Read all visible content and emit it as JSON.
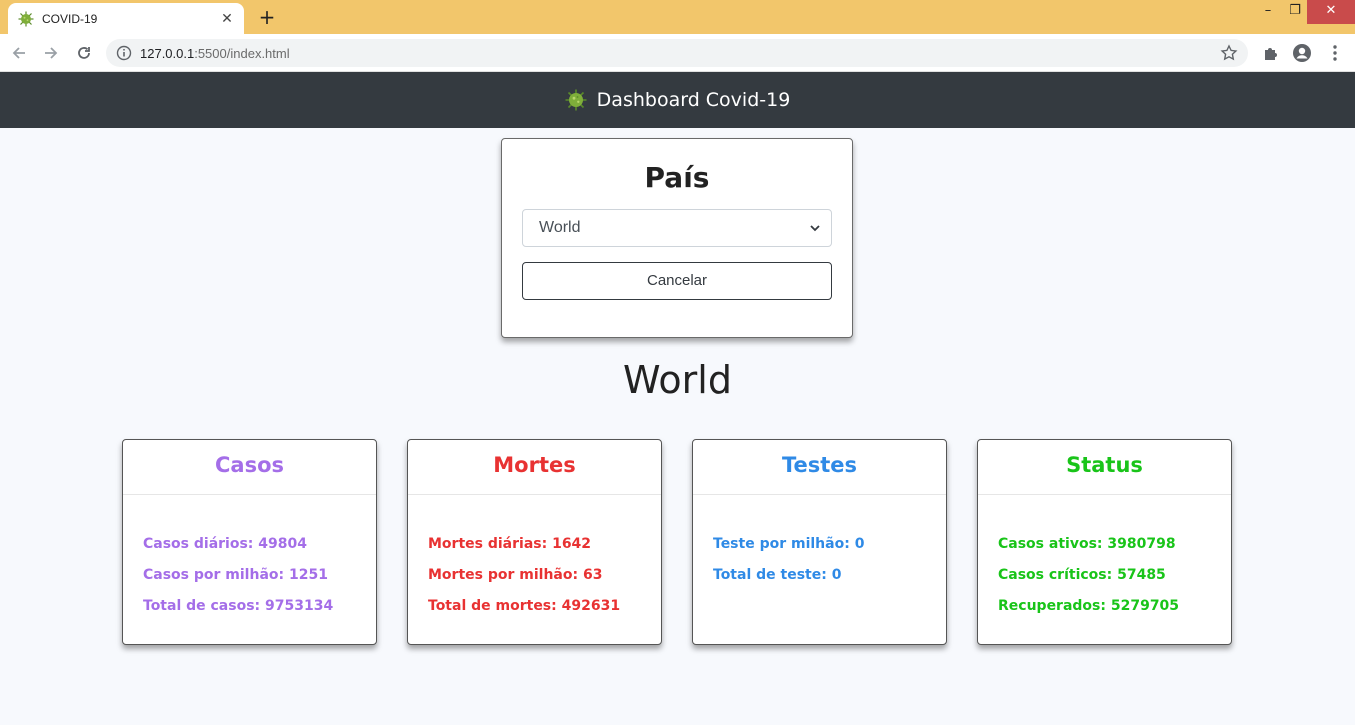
{
  "browser": {
    "tab_title": "COVID-19",
    "new_tab": "+",
    "url_host": "127.0.0.1",
    "url_rest": ":5500/index.html",
    "window_controls": {
      "minimize": "–",
      "restore": "❐",
      "close": "✕"
    }
  },
  "navbar": {
    "brand": "Dashboard Covid-19"
  },
  "country_form": {
    "title": "País",
    "selected": "World",
    "cancel_label": "Cancelar"
  },
  "country_name": "World",
  "cards": {
    "casos": {
      "title": "Casos",
      "color": "#a46ee8",
      "rows": [
        "Casos diários: 49804",
        "Casos por milhão: 1251",
        "Total de casos: 9753134"
      ]
    },
    "mortes": {
      "title": "Mortes",
      "color": "#e83232",
      "rows": [
        "Mortes diárias: 1642",
        "Mortes por milhão: 63",
        "Total de mortes: 492631"
      ]
    },
    "testes": {
      "title": "Testes",
      "color": "#2f8ae6",
      "rows": [
        "Teste por milhão: 0",
        "Total de teste: 0"
      ]
    },
    "status": {
      "title": "Status",
      "color": "#19c419",
      "rows": [
        "Casos ativos: 3980798",
        "Casos críticos: 57485",
        "Recuperados: 5279705"
      ]
    }
  },
  "icons": {
    "favicon": "virus-icon",
    "brand_logo": "virus-icon",
    "back": "arrow-left-icon",
    "forward": "arrow-right-icon",
    "reload": "reload-icon",
    "site_info": "info-icon",
    "bookmark": "star-icon",
    "extensions": "puzzle-icon",
    "profile": "profile-icon",
    "menu": "kebab-menu-icon"
  }
}
